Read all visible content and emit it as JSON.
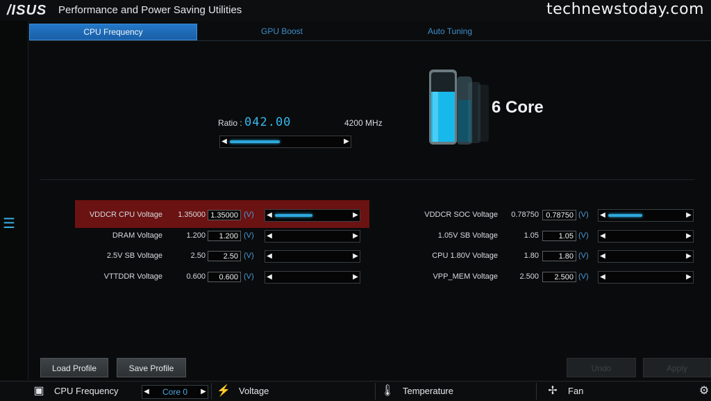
{
  "titlebar": {
    "logo": "/ISUS",
    "title": "Performance and Power Saving Utilities",
    "watermark": "technewstoday.com"
  },
  "tabs": [
    {
      "label": "CPU Frequency",
      "active": true
    },
    {
      "label": "GPU Boost",
      "active": false
    },
    {
      "label": "Auto Tuning",
      "active": false
    }
  ],
  "ratio": {
    "label": "Ratio :",
    "value": "042.00",
    "mhz": "4200 MHz",
    "slider_level": 0.45
  },
  "cores": {
    "label": "6 Core"
  },
  "voltages_left": [
    {
      "label": "VDDCR CPU Voltage",
      "default": "1.35000",
      "value": "1.35000",
      "unit": "(V)",
      "level": 0.5
    },
    {
      "label": "DRAM Voltage",
      "default": "1.200",
      "value": "1.200",
      "unit": "(V)",
      "level": 0
    },
    {
      "label": "2.5V SB Voltage",
      "default": "2.50",
      "value": "2.50",
      "unit": "(V)",
      "level": 0
    },
    {
      "label": "VTTDDR Voltage",
      "default": "0.600",
      "value": "0.600",
      "unit": "(V)",
      "level": 0
    }
  ],
  "voltages_right": [
    {
      "label": "VDDCR SOC Voltage",
      "default": "0.78750",
      "value": "0.78750",
      "unit": "(V)",
      "level": 0.45
    },
    {
      "label": "1.05V SB Voltage",
      "default": "1.05",
      "value": "1.05",
      "unit": "(V)",
      "level": 0
    },
    {
      "label": "CPU 1.80V Voltage",
      "default": "1.80",
      "value": "1.80",
      "unit": "(V)",
      "level": 0
    },
    {
      "label": "VPP_MEM Voltage",
      "default": "2.500",
      "value": "2.500",
      "unit": "(V)",
      "level": 0
    }
  ],
  "buttons": {
    "load": "Load Profile",
    "save": "Save Profile",
    "undo": "Undo",
    "apply": "Apply"
  },
  "bottombar": {
    "cpu_frequency": "CPU Frequency",
    "core_select": "Core 0",
    "voltage": "Voltage",
    "temperature": "Temperature",
    "fan": "Fan"
  },
  "colors": {
    "accent": "#2ea8dc",
    "highlight": "#6b1212",
    "tab_active": "#1f6cbc"
  }
}
